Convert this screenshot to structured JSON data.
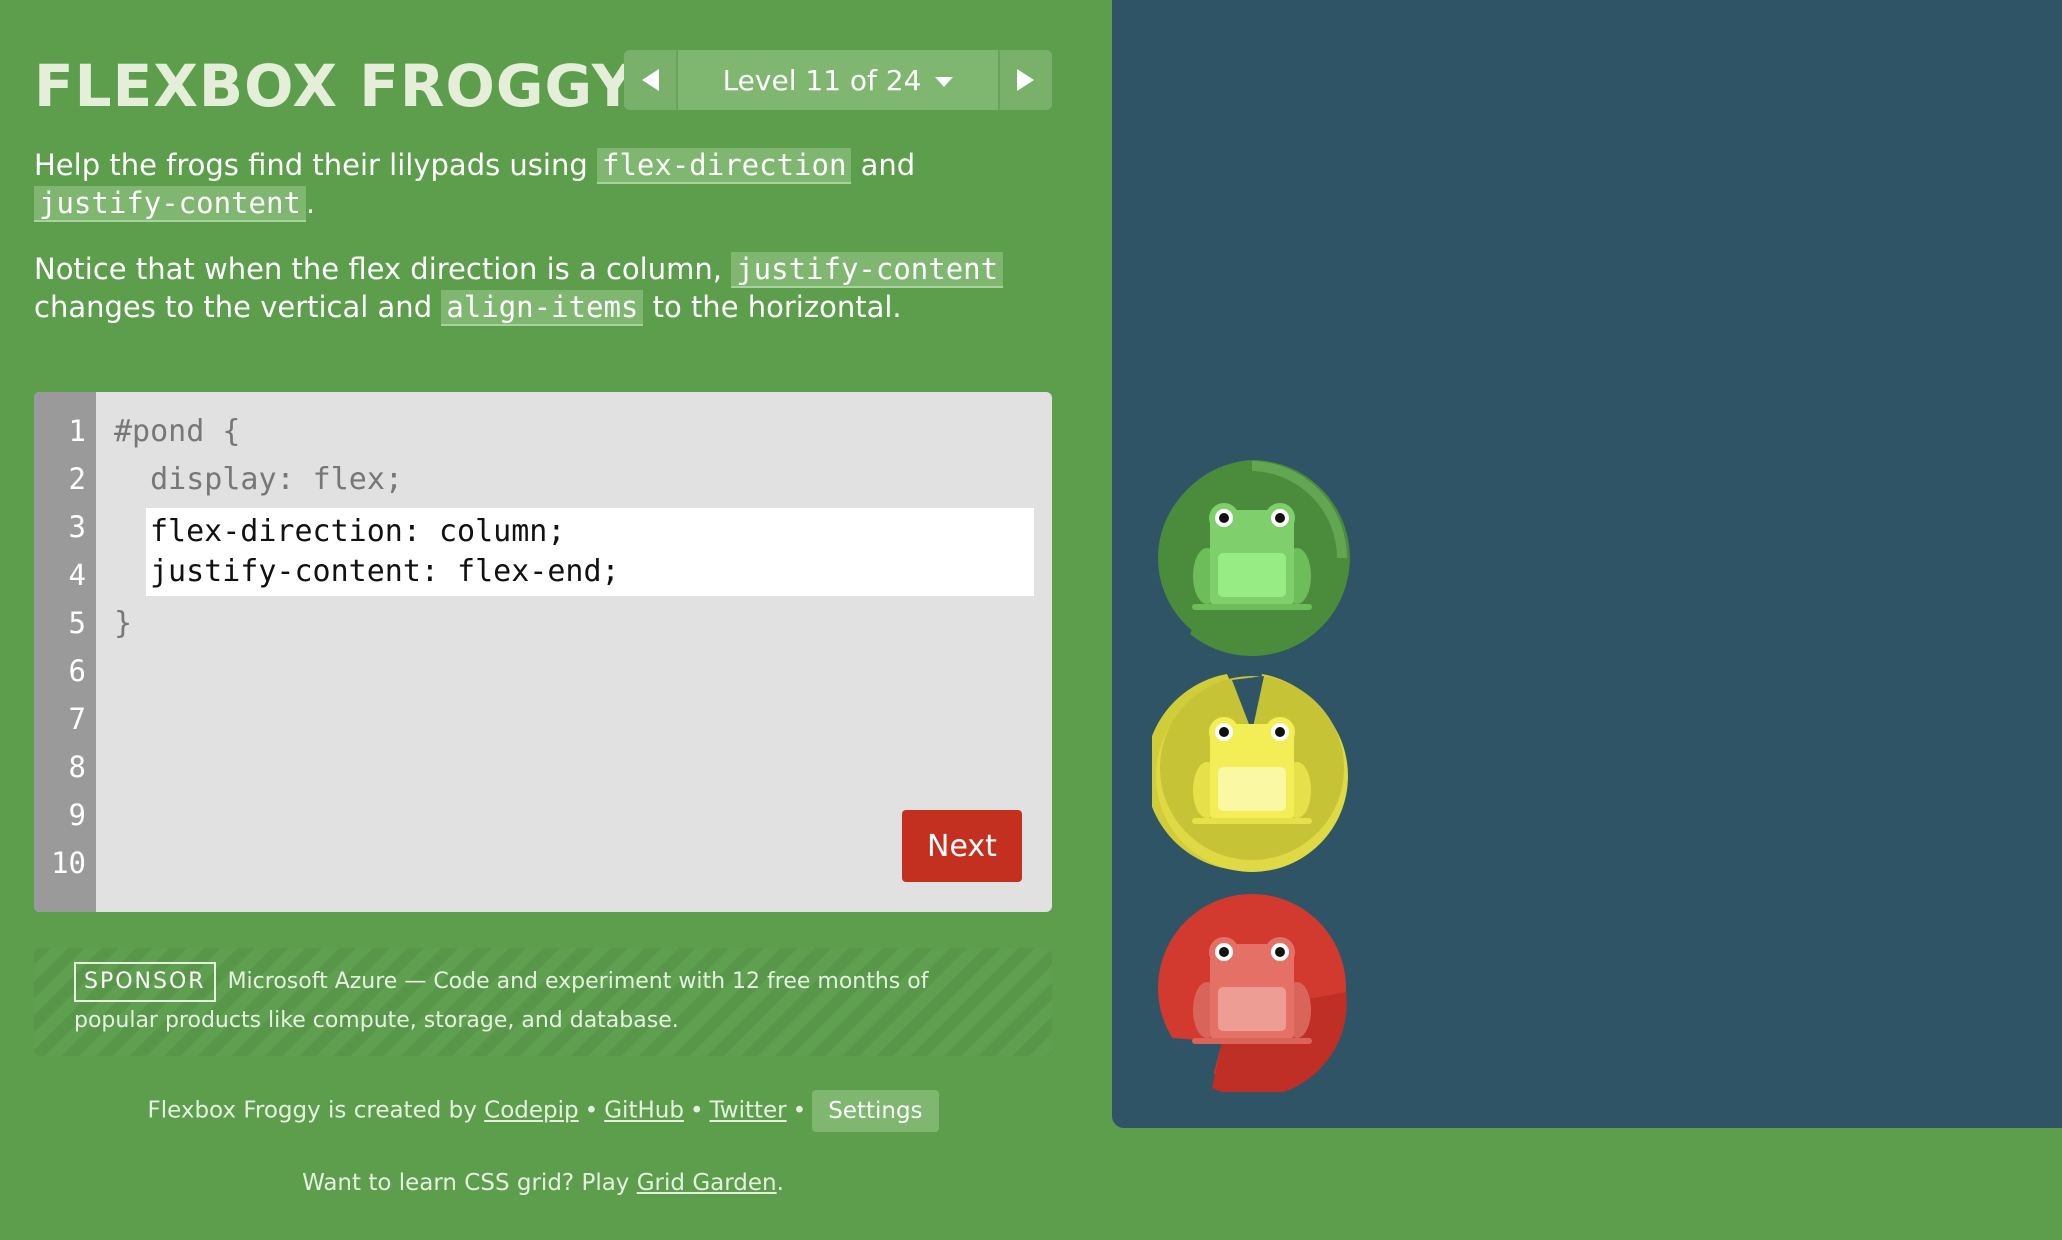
{
  "app": {
    "title": "FLEXBOX FROGGY"
  },
  "level_nav": {
    "label": "Level 11 of 24"
  },
  "instructions": {
    "p1_before": "Help the frogs find their lilypads using ",
    "p1_code1": "flex-direction",
    "p1_mid": " and",
    "p1_code2": "justify-content",
    "p1_end": ".",
    "p2_before": "Notice that when the flex direction is a column, ",
    "p2_code1": "justify-content",
    "p2_mid": " changes to the vertical and ",
    "p2_code2": "align-items",
    "p2_end": " to the horizontal."
  },
  "editor": {
    "line_numbers": [
      "1",
      "2",
      "3",
      "4",
      "5",
      "6",
      "7",
      "8",
      "9",
      "10"
    ],
    "line1": "#pond {",
    "line2": "  display: flex;",
    "input_value": "flex-direction: column;\njustify-content: flex-end;",
    "line5": "}",
    "next_label": "Next"
  },
  "sponsor": {
    "badge": "SPONSOR",
    "text": "Microsoft Azure — Code and experiment with 12 free months of popular products like compute, storage, and database."
  },
  "footer": {
    "credit_prefix": "Flexbox Froggy is created by ",
    "codepip": "Codepip",
    "github": "GitHub",
    "twitter": "Twitter",
    "settings": "Settings",
    "grid_prefix": "Want to learn CSS grid? Play ",
    "grid_link": "Grid Garden",
    "grid_end": "."
  },
  "colors": {
    "background": "#5d9e4d",
    "pond": "#2e5466",
    "green_frog": "#7fcf6c",
    "yellow_frog": "#f3ee55",
    "red_frog": "#e57066",
    "next_button": "#c3301f"
  },
  "frogs": [
    {
      "color": "green",
      "icon": "frog-icon"
    },
    {
      "color": "yellow",
      "icon": "frog-icon"
    },
    {
      "color": "red",
      "icon": "frog-icon"
    }
  ]
}
